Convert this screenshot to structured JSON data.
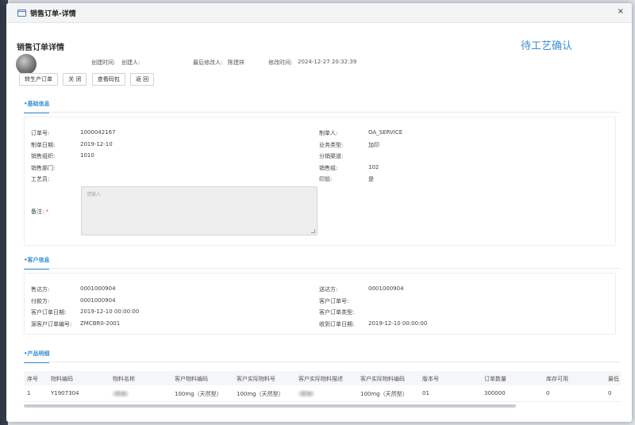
{
  "window": {
    "title": "销售订单-详情",
    "close": "×"
  },
  "header": {
    "page_title": "销售订单详情",
    "status": "待工艺确认",
    "created_time_label": "创建时间:",
    "creator_label": "创建人:",
    "last_modifier_label": "最后修改人:",
    "last_modifier": "陈建祥",
    "modified_time_label": "修改时间:",
    "modified_time": "2024-12-27 20:32:39"
  },
  "buttons": {
    "to_production": "转生产订单",
    "close": "关 闭",
    "view_code_pack": "查看码包",
    "back": "返 回"
  },
  "sections": {
    "basic": "•基础信息",
    "customer": "•客户信息",
    "products": "•产品明细"
  },
  "basic": {
    "order_no_label": "订单号:",
    "order_no": "1000042167",
    "order_date_label": "制单日期:",
    "order_date": "2019-12-10",
    "sales_org_label": "销售组织:",
    "sales_org": "1010",
    "sales_dept_label": "销售部门:",
    "craftsman_label": "工艺员:",
    "remark_label": "备注:",
    "remark_required": "*",
    "remark_placeholder": "请输入",
    "maker_label": "制单人:",
    "maker": "OA_SERVICE",
    "biz_type_label": "业务类型:",
    "biz_type": "加印",
    "channel_label": "分销渠道:",
    "sales_group_label": "销售组:",
    "sales_group": "102",
    "print_label": "印前:",
    "print": "是"
  },
  "customer": {
    "sold_to_label": "售达方:",
    "sold_to": "0001000904",
    "payer_label": "付款方:",
    "payer": "0001000904",
    "cust_order_date_label": "客户订单日期:",
    "cust_order_date": "2019-12-10 00:00:00",
    "src_order_no_label": "源客户订单编号:",
    "src_order_no": "ZMCBR0-2001",
    "ship_to_label": "送达方:",
    "ship_to": "0001000904",
    "cust_order_no_label": "客户订单号:",
    "cust_order_type_label": "客户订单类型:",
    "received_date_label": "收到订单日期:",
    "received_date": "2019-12-10 00:00:00"
  },
  "products": {
    "columns": [
      "序号",
      "物料编码",
      "物料名称",
      "客户物料编码",
      "客户实际物料号",
      "客户实际物料描述",
      "客户实际物料编码",
      "版本号",
      "订单数量",
      "库存可用",
      "最低"
    ],
    "rows": [
      [
        "1",
        "Y1907304",
        "(模糊)",
        "100mg（天然型）",
        "100mg（天然型）",
        "(模糊)",
        "100mg（天然型）",
        "01",
        "300000",
        "0",
        "0"
      ]
    ]
  },
  "colors": {
    "accent": "#3a8fd6",
    "required": "#e04545"
  }
}
